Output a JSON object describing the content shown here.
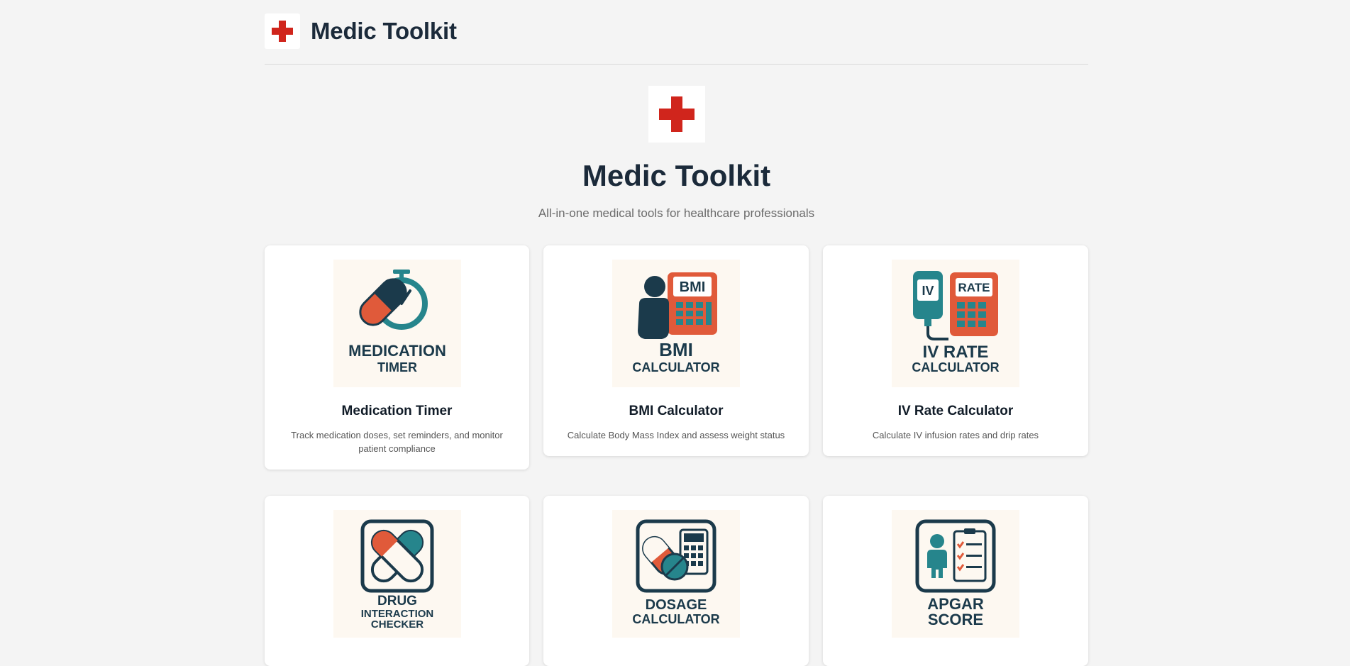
{
  "header": {
    "title": "Medic Toolkit"
  },
  "hero": {
    "title": "Medic Toolkit",
    "subtitle": "All-in-one medical tools for healthcare professionals"
  },
  "colors": {
    "navy": "#1b3a4b",
    "red": "#e05a3a",
    "teal": "#26858c",
    "cross": "#d0251c",
    "background": "#f4f4f4"
  },
  "tools": [
    {
      "title": "Medication Timer",
      "description": "Track medication doses, set reminders, and monitor patient compliance",
      "icon": "medication-timer-icon",
      "art": [
        "MEDICATION",
        "TIMER"
      ]
    },
    {
      "title": "BMI Calculator",
      "description": "Calculate Body Mass Index and assess weight status",
      "icon": "bmi-calculator-icon",
      "art": [
        "BMI",
        "BMI",
        "CALCULATOR"
      ]
    },
    {
      "title": "IV Rate Calculator",
      "description": "Calculate IV infusion rates and drip rates",
      "icon": "iv-rate-calculator-icon",
      "art": [
        "IV",
        "RATE",
        "IV RATE",
        "CALCULATOR"
      ]
    },
    {
      "title": "",
      "description": "",
      "icon": "drug-interaction-checker-icon",
      "art": [
        "DRUG",
        "INTERACTION",
        "CHECKER"
      ]
    },
    {
      "title": "",
      "description": "",
      "icon": "dosage-calculator-icon",
      "art": [
        "DOSAGE",
        "CALCULATOR"
      ]
    },
    {
      "title": "",
      "description": "",
      "icon": "apgar-score-icon",
      "art": [
        "APGAR",
        "SCORE"
      ]
    }
  ]
}
